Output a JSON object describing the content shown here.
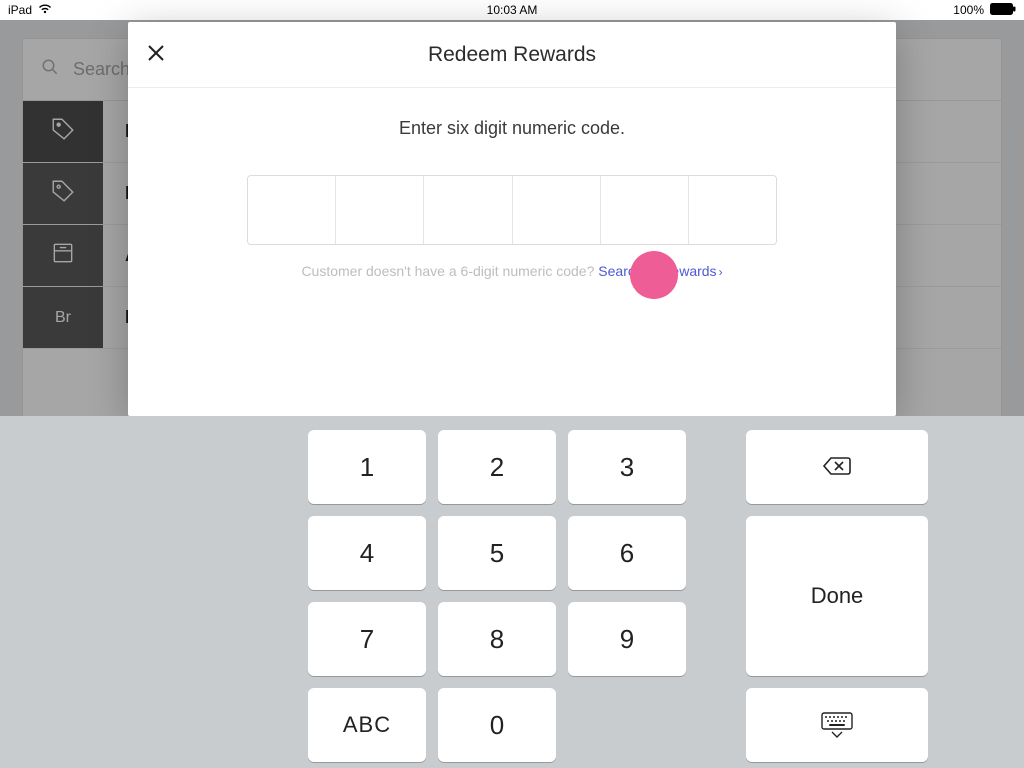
{
  "status": {
    "device": "iPad",
    "time": "10:03 AM",
    "battery": "100%"
  },
  "background": {
    "search_placeholder": "Search",
    "rows": [
      {
        "name": "redeem",
        "label": "Redeem Rewards",
        "icon": "tag-star"
      },
      {
        "name": "discounts",
        "label": "Discounts",
        "icon": "tag"
      },
      {
        "name": "all",
        "label": "All Items",
        "icon": "drawer"
      },
      {
        "name": "bread",
        "label": "Bread",
        "icon": "Br"
      }
    ]
  },
  "modal": {
    "title": "Redeem Rewards",
    "prompt": "Enter six digit numeric code.",
    "help_prefix": "Customer doesn't have a 6-digit numeric code? ",
    "help_link": "Search for rewards"
  },
  "keypad": {
    "k1": "1",
    "k2": "2",
    "k3": "3",
    "k4": "4",
    "k5": "5",
    "k6": "6",
    "k7": "7",
    "k8": "8",
    "k9": "9",
    "k0": "0",
    "abc": "ABC",
    "done": "Done"
  }
}
